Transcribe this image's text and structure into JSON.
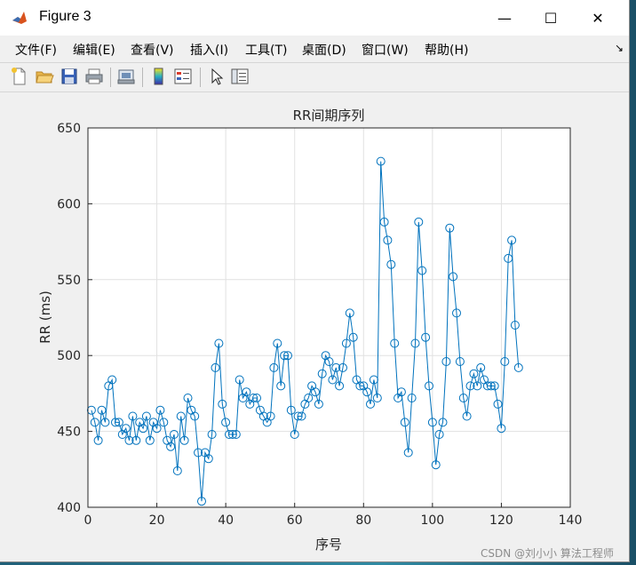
{
  "window": {
    "title": "Figure 3",
    "minimize": "—",
    "maximize": "☐",
    "close": "✕"
  },
  "menu": [
    {
      "label": "文件(F)"
    },
    {
      "label": "编辑(E)"
    },
    {
      "label": "查看(V)"
    },
    {
      "label": "插入(I)"
    },
    {
      "label": "工具(T)"
    },
    {
      "label": "桌面(D)"
    },
    {
      "label": "窗口(W)"
    },
    {
      "label": "帮助(H)"
    }
  ],
  "menu_overflow": "↘",
  "toolbar_icons": [
    "new-file-icon",
    "open-folder-icon",
    "save-icon",
    "print-icon",
    "print-preview-icon",
    "colorbar-icon",
    "legend-icon",
    "pointer-icon",
    "property-inspector-icon"
  ],
  "colors": {
    "series": "#0072BD",
    "grid": "#e1e1e1",
    "axes": "#262626"
  },
  "chart_data": {
    "type": "line",
    "title": "RR间期序列",
    "xlabel": "序号",
    "ylabel": "RR (ms)",
    "xlim": [
      0,
      140
    ],
    "ylim": [
      400,
      650
    ],
    "xticks": [
      0,
      20,
      40,
      60,
      80,
      100,
      120,
      140
    ],
    "yticks": [
      400,
      450,
      500,
      550,
      600,
      650
    ],
    "grid": true,
    "marker": "circle",
    "x": [
      1,
      2,
      3,
      4,
      5,
      6,
      7,
      8,
      9,
      10,
      11,
      12,
      13,
      14,
      15,
      16,
      17,
      18,
      19,
      20,
      21,
      22,
      23,
      24,
      25,
      26,
      27,
      28,
      29,
      30,
      31,
      32,
      33,
      34,
      35,
      36,
      37,
      38,
      39,
      40,
      41,
      42,
      43,
      44,
      45,
      46,
      47,
      48,
      49,
      50,
      51,
      52,
      53,
      54,
      55,
      56,
      57,
      58,
      59,
      60,
      61,
      62,
      63,
      64,
      65,
      66,
      67,
      68,
      69,
      70,
      71,
      72,
      73,
      74,
      75,
      76,
      77,
      78,
      79,
      80,
      81,
      82,
      83,
      84,
      85,
      86,
      87,
      88,
      89,
      90,
      91,
      92,
      93,
      94,
      95,
      96,
      97,
      98,
      99,
      100,
      101,
      102,
      103,
      104,
      105,
      106,
      107,
      108,
      109,
      110,
      111,
      112,
      113,
      114,
      115,
      116,
      117,
      118,
      119,
      120,
      121,
      122,
      123,
      124,
      125
    ],
    "y": [
      464,
      456,
      444,
      464,
      456,
      480,
      484,
      456,
      456,
      448,
      452,
      444,
      460,
      444,
      456,
      452,
      460,
      444,
      456,
      452,
      464,
      456,
      444,
      440,
      448,
      424,
      460,
      444,
      472,
      464,
      460,
      436,
      404,
      436,
      432,
      448,
      492,
      508,
      468,
      456,
      448,
      448,
      448,
      484,
      472,
      476,
      468,
      472,
      472,
      464,
      460,
      456,
      460,
      492,
      508,
      480,
      500,
      500,
      464,
      448,
      460,
      460,
      468,
      472,
      480,
      476,
      468,
      488,
      500,
      496,
      484,
      492,
      480,
      492,
      508,
      528,
      512,
      484,
      480,
      480,
      476,
      468,
      484,
      472,
      628,
      588,
      576,
      560,
      508,
      472,
      476,
      456,
      436,
      472,
      508,
      588,
      556,
      512,
      480,
      456,
      428,
      448,
      456,
      496,
      584,
      552,
      528,
      496,
      472,
      460,
      480,
      488,
      480,
      492,
      484,
      480,
      480,
      480,
      468,
      452,
      496,
      564,
      576,
      520,
      492
    ]
  },
  "watermark": "CSDN @刘小小 算法工程师"
}
